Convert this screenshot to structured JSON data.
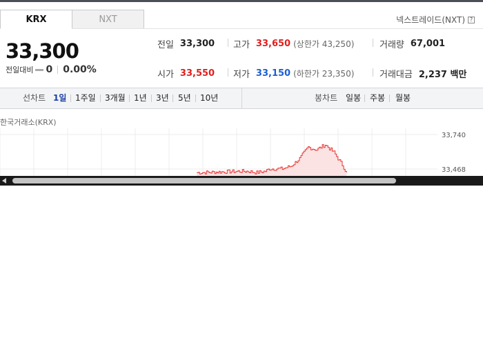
{
  "market_tabs": [
    {
      "label": "KRX",
      "active": true
    },
    {
      "label": "NXT",
      "active": false
    }
  ],
  "nextrade_link": {
    "label": "넥스트레이드(NXT)",
    "help": "?"
  },
  "price": {
    "current": "33,300",
    "change_label": "전일대비",
    "change_value": "0",
    "change_pct": "0.00%"
  },
  "stats": {
    "prev_close": {
      "label": "전일",
      "value": "33,300"
    },
    "high": {
      "label": "고가",
      "value": "33,650",
      "limit": "(상한가 43,250)"
    },
    "volume": {
      "label": "거래량",
      "value": "67,001"
    },
    "open": {
      "label": "시가",
      "value": "33,550"
    },
    "low": {
      "label": "저가",
      "value": "33,150",
      "limit": "(하한가 23,350)"
    },
    "amount": {
      "label": "거래대금",
      "value": "2,237 백만"
    }
  },
  "periods": {
    "line_label": "선차트",
    "line_items": [
      "1일",
      "1주일",
      "3개월",
      "1년",
      "3년",
      "5년",
      "10년"
    ],
    "selected": "1일",
    "candle_label": "봉차트",
    "candle_items": [
      "일봉",
      "주봉",
      "월봉"
    ]
  },
  "chart_title": "한국거래소(KRX)",
  "chart_data": {
    "type": "area",
    "title": "한국거래소(KRX)",
    "y_ticks": [
      33740,
      33468
    ],
    "y_tick_labels": [
      "33,740",
      "33,468"
    ],
    "visible_y_range": [
      33420,
      33740
    ],
    "x_range": [
      0,
      1
    ],
    "x_values": [
      0.46,
      0.47,
      0.56,
      0.58,
      0.6,
      0.62,
      0.63,
      0.66,
      0.68,
      0.7,
      0.72,
      0.74,
      0.76,
      0.78,
      0.8,
      0.81
    ],
    "values": [
      33440,
      33440,
      33450,
      33450,
      33440,
      33450,
      33470,
      33470,
      33490,
      33550,
      33640,
      33620,
      33660,
      33600,
      33500,
      33440
    ],
    "series_color": "#e8312f",
    "fill_color": "#fbe3e3"
  },
  "scrollbar": {
    "arrow_icon": "left-arrow"
  }
}
